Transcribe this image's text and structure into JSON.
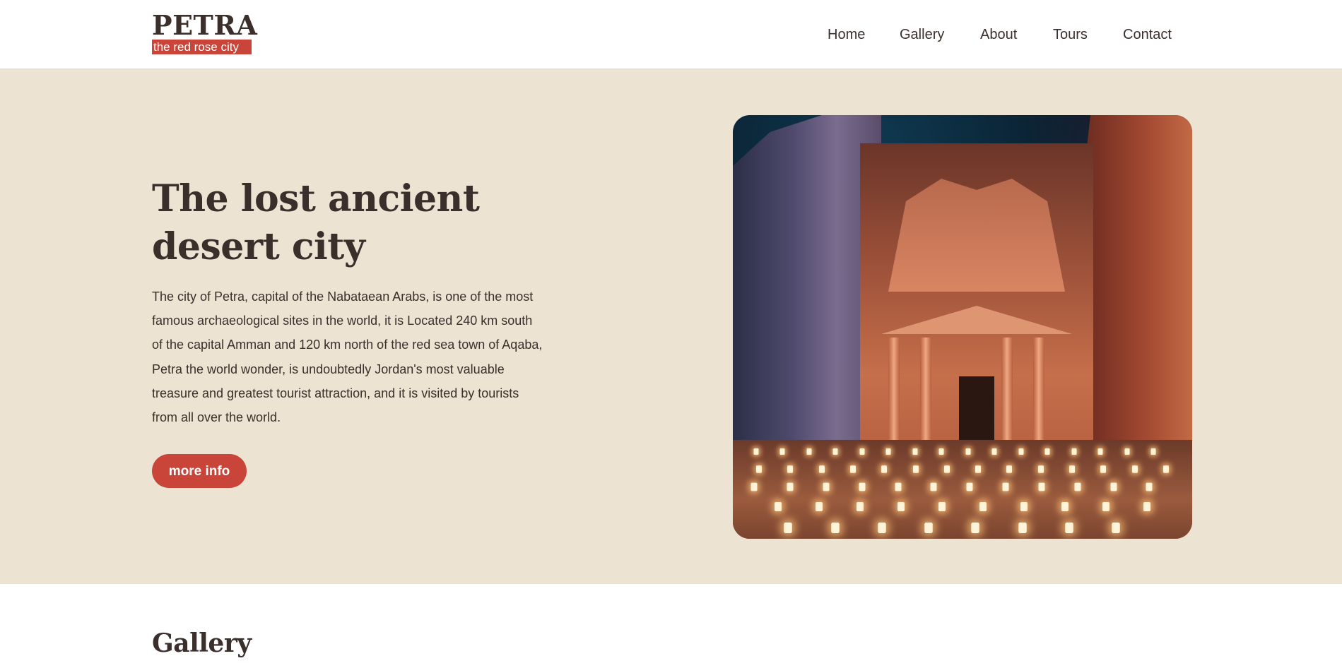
{
  "header": {
    "logo_title": "PETRA",
    "logo_tagline": "the red rose city",
    "nav": [
      {
        "label": "Home"
      },
      {
        "label": "Gallery"
      },
      {
        "label": "About"
      },
      {
        "label": "Tours"
      },
      {
        "label": "Contact"
      }
    ]
  },
  "hero": {
    "title_line1": "The lost ancient",
    "title_line2": "desert city",
    "description": "The city of Petra, capital of the Nabataean Arabs, is one of the most famous archaeological sites in the world, it is Located 240 km south of the capital Amman and 120 km north of the red sea town of Aqaba, Petra the world wonder, is undoubtedly Jordan's most valuable treasure and greatest tourist attraction, and it is visited by tourists from all over the world.",
    "button_label": "more info"
  },
  "gallery": {
    "heading": "Gallery"
  },
  "colors": {
    "accent": "#c9453a",
    "hero_bg": "#ece3d2",
    "text": "#3b2f2b"
  }
}
